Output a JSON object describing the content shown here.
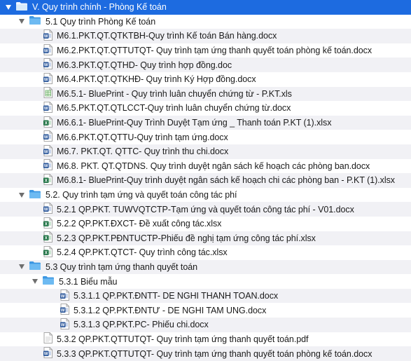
{
  "colors": {
    "selection": "#1d6be0",
    "folder": "#5fb0ee",
    "word": "#2b579a",
    "excel": "#217346"
  },
  "tree": {
    "root": {
      "label": "V. Quy trình chính - Phòng Kế toán",
      "icon": "folder-icon"
    },
    "f51": {
      "label": "5.1 Quy trình Phòng Kế toán",
      "icon": "folder-icon",
      "files": [
        {
          "label": "M6.1.PKT.QT.QTKTBH-Quy trình Kế toán Bán hàng.docx",
          "icon": "word-doc-icon"
        },
        {
          "label": "M6.2.PKT.QT.QTTUTQT- Quy trình tạm ứng thanh quyết toán phòng kế toán.docx",
          "icon": "word-doc-icon"
        },
        {
          "label": "M6.3.PKT.QT.QTHD- Quy trình hợp đồng.doc",
          "icon": "word-doc-icon"
        },
        {
          "label": "M6.4.PKT.QT.QTKHĐ- Quy trình Ký Hợp đồng.docx",
          "icon": "word-doc-icon"
        },
        {
          "label": "M6.5.1- BluePrint - Quy trình luân chuyển chứng từ - P.KT.xls",
          "icon": "spreadsheet-icon"
        },
        {
          "label": "M6.5.PKT.QT.QTLCCT-Quy trình luân chuyển chứng từ.docx",
          "icon": "word-doc-icon"
        },
        {
          "label": "M6.6.1- BluePrint-Quy Trình Duyệt Tạm ứng _ Thanh toán P.KT (1).xlsx",
          "icon": "excel-icon"
        },
        {
          "label": "M6.6.PKT.QT.QTTU-Quy trình tạm ứng.docx",
          "icon": "word-doc-icon"
        },
        {
          "label": "M6.7. PKT.QT. QTTC- Quy trình thu chi.docx",
          "icon": "word-doc-icon"
        },
        {
          "label": "M6.8. PKT. QT.QTDNS. Quy trình duyệt ngân sách kế hoạch các phòng ban.docx",
          "icon": "word-doc-icon"
        },
        {
          "label": "M6.8.1- BluePrint-Quy trình duyệt ngân sách kế hoạch chi các phòng ban - P.KT (1).xlsx",
          "icon": "excel-icon"
        }
      ]
    },
    "f52": {
      "label": "5.2. Quy trình tạm ứng và quyết toán công tác phí",
      "icon": "folder-icon",
      "files": [
        {
          "label": "5.2.1 QP.PKT. TUWVQTCTP-Tạm ứng và quyết toán công tác phí - V01.docx",
          "icon": "word-doc-icon"
        },
        {
          "label": "5.2.2 QP.PKT.ĐXCT- Đề xuất công tác.xlsx",
          "icon": "excel-icon"
        },
        {
          "label": "5.2.3 QP.PKT.PĐNTUCTP-Phiếu đề nghị tạm ứng công tác phí.xlsx",
          "icon": "excel-icon"
        },
        {
          "label": "5.2.4 QP.PKT.QTCT- Quy trình công tác.xlsx",
          "icon": "excel-icon"
        }
      ]
    },
    "f53": {
      "label": "5.3 Quy trình tạm ứng thanh quyết toán",
      "icon": "folder-icon",
      "sub": {
        "label": "5.3.1 Biểu mẫu",
        "icon": "folder-icon",
        "files": [
          {
            "label": "5.3.1.1 QP.PKT.ĐNTT- DE NGHI THANH TOAN.docx",
            "icon": "word-doc-icon"
          },
          {
            "label": "5.3.1.2 QP.PKT.ĐNTƯ - DE NGHI TAM UNG.docx",
            "icon": "word-doc-icon"
          },
          {
            "label": "5.3.1.3 QP.PKT.PC- Phiếu chi.docx",
            "icon": "word-doc-icon"
          }
        ]
      },
      "files": [
        {
          "label": "5.3.2 QP.PKT.QTTUTQT- Quy trình tạm ứng thanh quyết toán.pdf",
          "icon": "pdf-icon"
        },
        {
          "label": "5.3.3 QP.PKT.QTTUTQT- Quy trình tạm ứng thanh quyết toán phòng kế toán.docx",
          "icon": "word-doc-icon"
        }
      ]
    }
  }
}
